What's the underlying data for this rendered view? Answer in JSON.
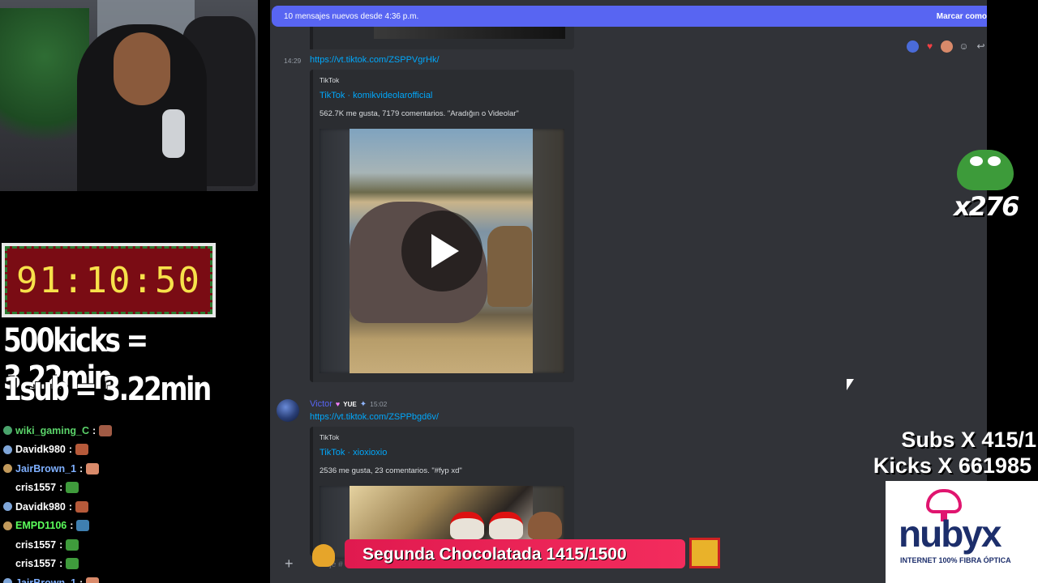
{
  "stream": {
    "timer": "91:10:50",
    "rate_kicks": "500kicks = 3.22min",
    "rate_sub": "1sub = 3.22min",
    "emote_count": "x276",
    "subs_goal": "Subs X 415/1",
    "kicks_goal": "Kicks X 661985",
    "sponsor_name": "nubyx",
    "sponsor_tagline": "INTERNET 100% FIBRA ÓPTICA",
    "choco_goal": "Segunda Chocolatada 1415/1500"
  },
  "chat": [
    {
      "user": "wiki_gaming_C",
      "color": "#5bd46a",
      "badge": "#4aa36b",
      "emote": "#a15b45"
    },
    {
      "user": "Davidk980",
      "color": "#ffffff",
      "badge": "#7fa6d9",
      "emote": "#b65a3a"
    },
    {
      "user": "JairBrown_1",
      "color": "#7fb0ff",
      "badge": "#c29a5b",
      "emote": "#d98a6a"
    },
    {
      "user": "cris1557",
      "color": "#ffffff",
      "badge": "",
      "emote": "#3f9b3c"
    },
    {
      "user": "Davidk980",
      "color": "#ffffff",
      "badge": "#7fa6d9",
      "emote": "#b65a3a"
    },
    {
      "user": "EMPD1106",
      "color": "#5bff5b",
      "badge": "#c29a5b",
      "emote": "#3f7fb0"
    },
    {
      "user": "cris1557",
      "color": "#ffffff",
      "badge": "",
      "emote": "#3f9b3c"
    },
    {
      "user": "cris1557",
      "color": "#ffffff",
      "badge": "",
      "emote": "#3f9b3c"
    },
    {
      "user": "JairBrown_1",
      "color": "#7fb0ff",
      "badge": "#7fa6d9",
      "emote": "#d98a6a"
    }
  ],
  "discord": {
    "new_messages_banner": "10 mensajes nuevos desde 4:36 p.m.",
    "mark_read": "Marcar como",
    "msg1": {
      "time": "14:29",
      "link": "https://vt.tiktok.com/ZSPPVgrHk/",
      "provider": "TikTok",
      "title": "TikTok · komikvideolarofficial",
      "description": "562.7K me gusta, 7179 comentarios. \"Aradığın o Videolar\""
    },
    "msg2": {
      "author": "Victor",
      "tag": "YUE",
      "time": "15:02",
      "link": "https://vt.tiktok.com/ZSPPbgd6v/",
      "provider": "TikTok",
      "title": "TikTok · xioxioxio",
      "description": "2536 me gusta, 23 comentarios. \"#fyp xd\""
    },
    "composer_placeholder": "saje # clips",
    "add_button": "+"
  },
  "colors": {
    "discord_bg": "#313338",
    "banner": "#5865f2",
    "link": "#00a8fc",
    "timer_digits": "#f7e14a",
    "choco_banner": "#e01a4f"
  }
}
